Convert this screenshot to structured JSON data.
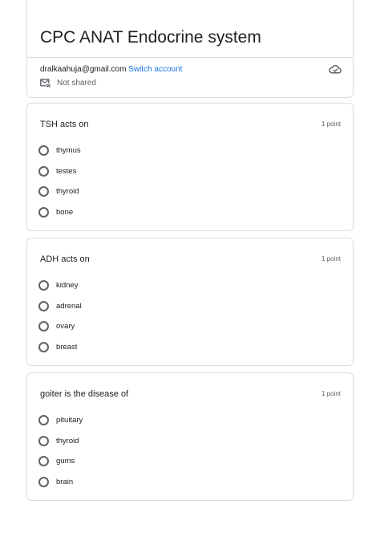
{
  "form": {
    "title": "CPC ANAT Endocrine system",
    "account_email": "dralkaahuja@gmail.com",
    "switch_account": "Switch account",
    "sharing_status": "Not shared"
  },
  "questions": [
    {
      "title": "TSH acts on",
      "points": "1 point",
      "options": [
        "thymus",
        "testes",
        "thyroid",
        "bone"
      ]
    },
    {
      "title": "ADH acts on",
      "points": "1 point",
      "options": [
        "kidney",
        "adrenal",
        "ovary",
        "breast"
      ]
    },
    {
      "title": "goiter is the disease of",
      "points": "1 point",
      "options": [
        "pituitary",
        "thyroid",
        "gums",
        "brain"
      ]
    }
  ],
  "icons": {
    "cloud": "cloud-saved-icon",
    "mail": "mail-not-shared-icon",
    "radio": "radio-unchecked-icon"
  },
  "colors": {
    "link": "#1a73e8",
    "border": "#dadce0",
    "text": "#202124",
    "muted": "#5f6368"
  }
}
